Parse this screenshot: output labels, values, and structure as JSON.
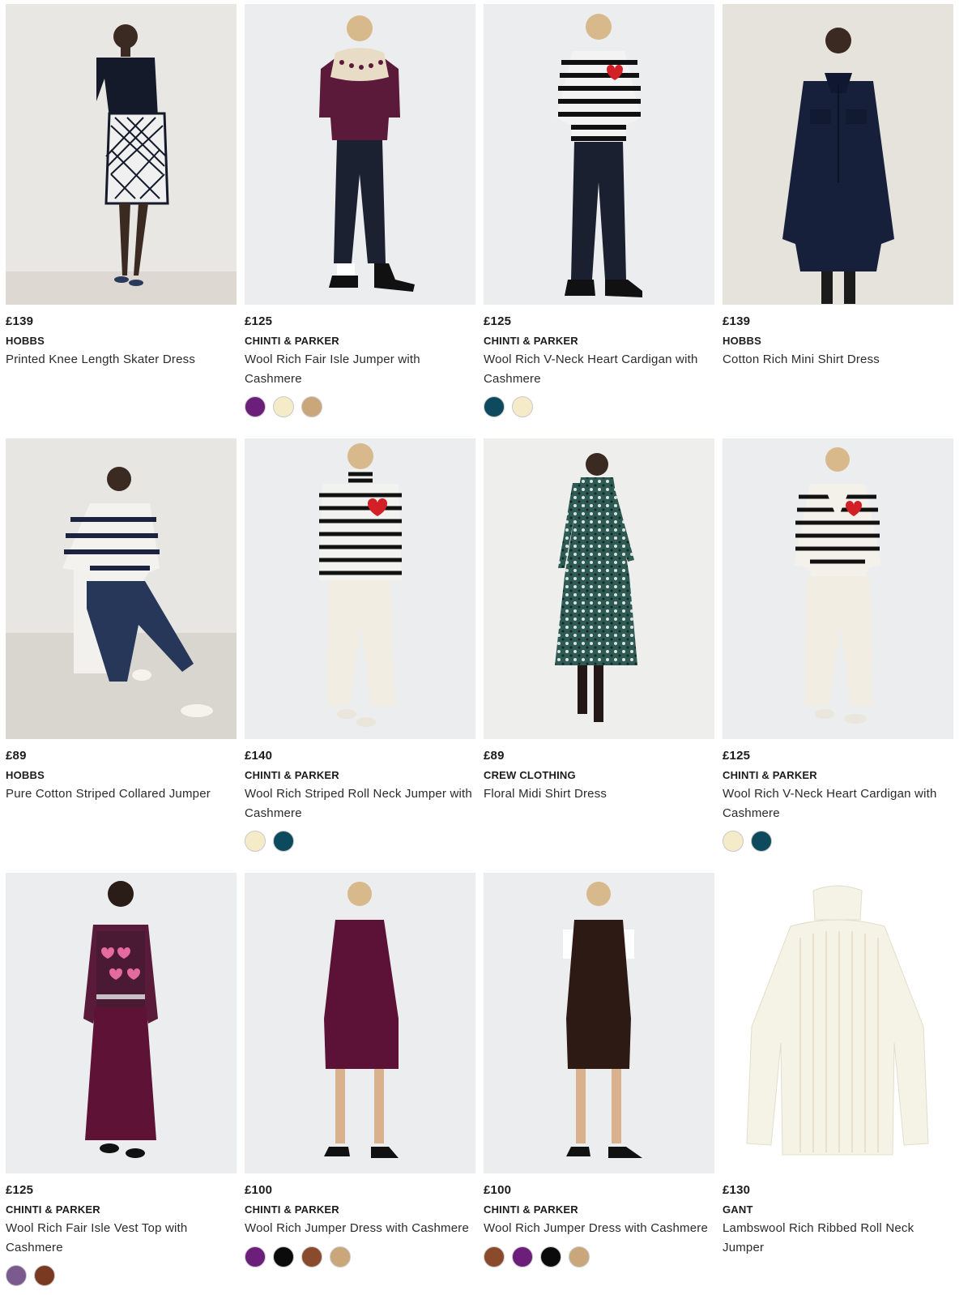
{
  "products": [
    {
      "price": "£139",
      "brand": "HOBBS",
      "title": "Printed Knee Length Skater Dress",
      "swatches": [],
      "image_bg": "#e9e7e3",
      "image_icon": "skater-dress-model-image"
    },
    {
      "price": "£125",
      "brand": "CHINTI & PARKER",
      "title": "Wool Rich Fair Isle Jumper with Cashmere",
      "swatches": [
        "#6b1e7a",
        "#f6ebc8",
        "#c9a77a"
      ],
      "image_bg": "#ecedef",
      "image_icon": "fair-isle-jumper-model-image"
    },
    {
      "price": "£125",
      "brand": "CHINTI & PARKER",
      "title": "Wool Rich V-Neck Heart Cardigan with Cashmere",
      "swatches": [
        "#0e4a5e",
        "#f6ebc8"
      ],
      "image_bg": "#ecedef",
      "image_icon": "heart-cardigan-model-image"
    },
    {
      "price": "£139",
      "brand": "HOBBS",
      "title": "Cotton Rich Mini Shirt Dress",
      "swatches": [],
      "image_bg": "#e6e3dd",
      "image_icon": "shirt-dress-model-image"
    },
    {
      "price": "£89",
      "brand": "HOBBS",
      "title": "Pure Cotton Striped Collared Jumper",
      "swatches": [],
      "image_bg": "#e8e6e2",
      "image_icon": "striped-collared-jumper-model-image"
    },
    {
      "price": "£140",
      "brand": "CHINTI & PARKER",
      "title": "Wool Rich Striped Roll Neck Jumper with Cashmere",
      "swatches": [
        "#f6ebc8",
        "#0e4a5e"
      ],
      "image_bg": "#ecedef",
      "image_icon": "striped-roll-neck-model-image"
    },
    {
      "price": "£89",
      "brand": "CREW CLOTHING",
      "title": "Floral Midi Shirt Dress",
      "swatches": [],
      "image_bg": "#eeeeec",
      "image_icon": "floral-midi-dress-model-image"
    },
    {
      "price": "£125",
      "brand": "CHINTI & PARKER",
      "title": "Wool Rich V-Neck Heart Cardigan with Cashmere",
      "swatches": [
        "#f6ebc8",
        "#0e4a5e"
      ],
      "image_bg": "#ecedef",
      "image_icon": "heart-cardigan-cream-model-image"
    },
    {
      "price": "£125",
      "brand": "CHINTI & PARKER",
      "title": "Wool Rich Fair Isle Vest Top with Cashmere",
      "swatches": [
        "#7a5a8f",
        "#7a3a22"
      ],
      "image_bg": "#ecedef",
      "image_icon": "fair-isle-vest-model-image"
    },
    {
      "price": "£100",
      "brand": "CHINTI & PARKER",
      "title": "Wool Rich Jumper Dress with Cashmere",
      "swatches": [
        "#6b1e7a",
        "#0b0b0b",
        "#8a4a2c",
        "#c9a77a"
      ],
      "image_bg": "#ecedef",
      "image_icon": "jumper-dress-purple-model-image"
    },
    {
      "price": "£100",
      "brand": "CHINTI & PARKER",
      "title": "Wool Rich Jumper Dress with Cashmere",
      "swatches": [
        "#8a4a2c",
        "#6b1e7a",
        "#0b0b0b",
        "#c9a77a"
      ],
      "image_bg": "#ecedef",
      "image_icon": "jumper-dress-brown-model-image"
    },
    {
      "price": "£130",
      "brand": "GANT",
      "title": "Lambswool Rich Ribbed Roll Neck Jumper",
      "swatches": [],
      "image_bg": "#ffffff",
      "image_icon": "ribbed-roll-neck-product-image"
    }
  ]
}
